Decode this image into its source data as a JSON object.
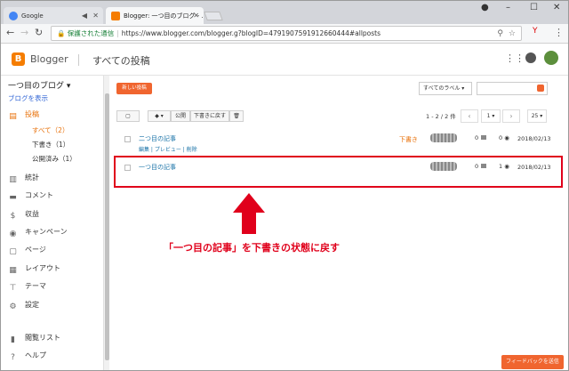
{
  "browser": {
    "tabs": [
      {
        "label": "Google"
      },
      {
        "label": "Blogger: 一つ目のブログ - ..."
      }
    ],
    "secure_label": "保護された通信",
    "url": "https://www.blogger.com/blogger.g?blogID=4791907591912660444#allposts"
  },
  "app": {
    "brand": "Blogger",
    "page_title": "すべての投稿",
    "accent_color": "#f57d00"
  },
  "sidebar": {
    "blog_name": "一つ目のブログ ▾",
    "view_blog": "ブログを表示",
    "items": [
      {
        "label": "投稿",
        "icon": "posts-icon"
      },
      {
        "label": "統計",
        "icon": "stats-icon"
      },
      {
        "label": "コメント",
        "icon": "comment-icon"
      },
      {
        "label": "収益",
        "icon": "earnings-icon"
      },
      {
        "label": "キャンペーン",
        "icon": "campaign-icon"
      },
      {
        "label": "ページ",
        "icon": "pages-icon"
      },
      {
        "label": "レイアウト",
        "icon": "layout-icon"
      },
      {
        "label": "テーマ",
        "icon": "theme-icon"
      },
      {
        "label": "設定",
        "icon": "settings-icon"
      },
      {
        "label": "閲覧リスト",
        "icon": "reading-list-icon"
      },
      {
        "label": "ヘルプ",
        "icon": "help-icon"
      }
    ],
    "subitems": [
      {
        "label": "すべて（2）"
      },
      {
        "label": "下書き（1）"
      },
      {
        "label": "公開済み（1）"
      }
    ]
  },
  "main": {
    "new_post": "新しい投稿",
    "label_filter": "すべてのラベル",
    "toolbar": {
      "label_btn": "▾",
      "publish": "公開",
      "revert": "下書きに戻す",
      "delete": "🗑"
    },
    "page_count": "1 - 2 / 2 件",
    "page_select": "1",
    "per_page": "25",
    "posts": [
      {
        "title": "二つ目の記事",
        "actions": "編集 | プレビュー | 削除",
        "status": "下書き",
        "comments": "0",
        "views": "0",
        "date": "2018/02/13"
      },
      {
        "title": "一つ目の記事",
        "actions": "",
        "status": "",
        "comments": "0",
        "views": "1",
        "date": "2018/02/13"
      }
    ]
  },
  "annotation": {
    "caption": "「一つ目の記事」を下書きの状態に戻す",
    "color": "#e0001b"
  },
  "feedback_button": "フィードバックを送信"
}
